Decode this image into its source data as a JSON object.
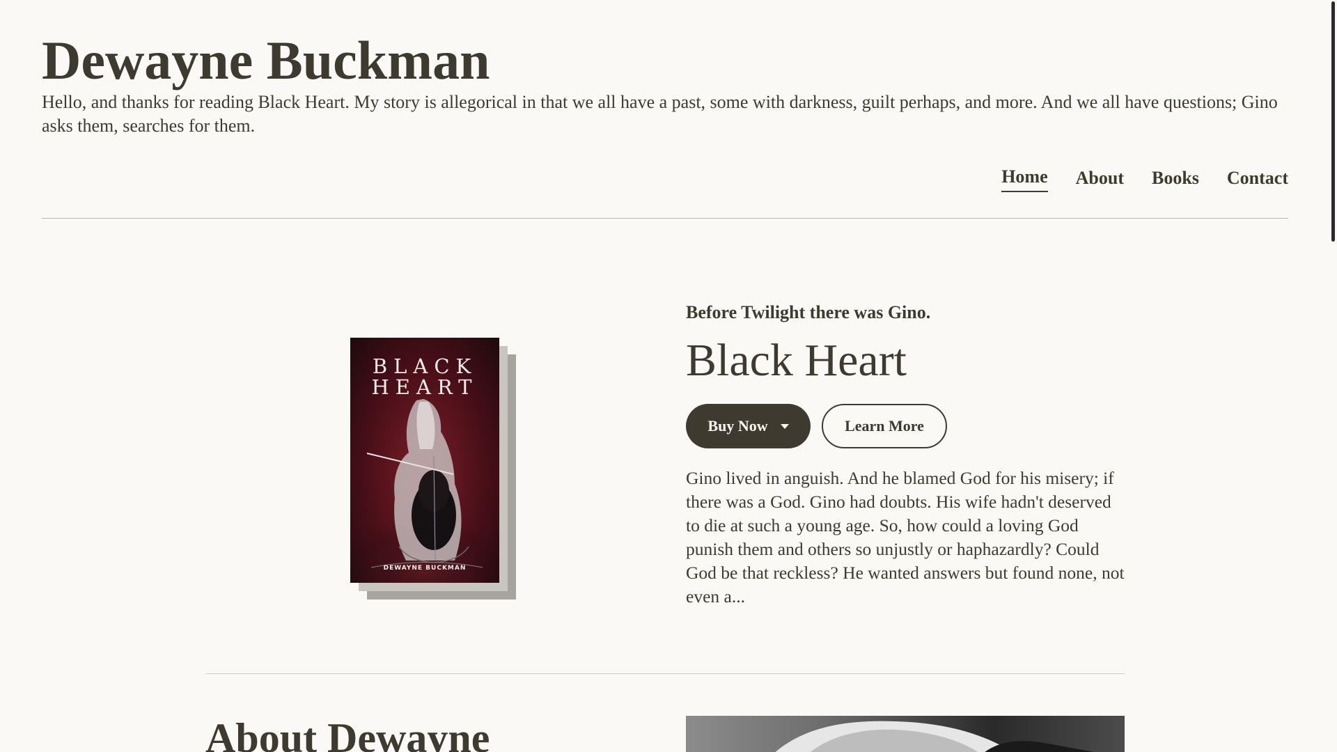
{
  "site": {
    "title": "Dewayne Buckman",
    "tagline": "Hello, and thanks for reading Black Heart. My story is allegorical in that we all have a past, some with darkness, guilt perhaps, and more. And we all have questions; Gino asks them, searches for them."
  },
  "nav": {
    "items": [
      {
        "label": "Home",
        "active": true
      },
      {
        "label": "About",
        "active": false
      },
      {
        "label": "Books",
        "active": false
      },
      {
        "label": "Contact",
        "active": false
      }
    ]
  },
  "book": {
    "kicker": "Before Twilight there was Gino.",
    "title": "Black Heart",
    "cover_title_line1": "BLACK",
    "cover_title_line2": "HEART",
    "cover_author": "DEWAYNE BUCKMAN",
    "buy_label": "Buy Now",
    "learn_label": "Learn More",
    "synopsis": "Gino lived in anguish. And he blamed God for his misery; if there was a God. Gino had doubts. His wife hadn't deserved to die at such a young age. So, how could a loving God punish them and others so unjustly or haphazardly? Could God be that reckless? He wanted answers but found none, not even a..."
  },
  "about": {
    "heading": "About Dewayne"
  },
  "colors": {
    "background": "#faf9f5",
    "text": "#3f3a30",
    "primary_button": "#3f3a30"
  }
}
